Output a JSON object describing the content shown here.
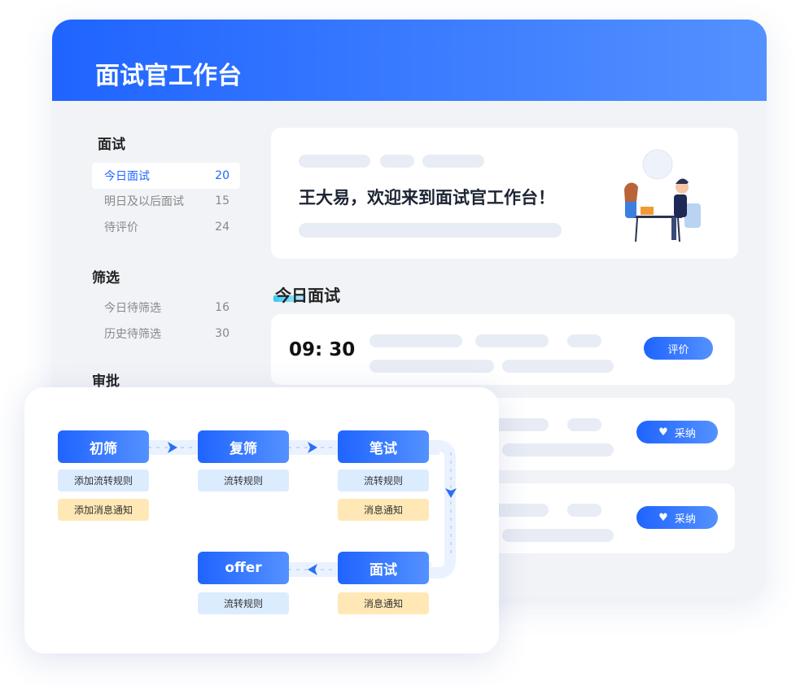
{
  "header": {
    "title": "面试官工作台"
  },
  "sidebar": {
    "sections": [
      {
        "title": "面试",
        "items": [
          {
            "label": "今日面试",
            "count": "20",
            "active": true
          },
          {
            "label": "明日及以后面试",
            "count": "15"
          },
          {
            "label": "待评价",
            "count": "24"
          }
        ]
      },
      {
        "title": "筛选",
        "items": [
          {
            "label": "今日待筛选",
            "count": "16"
          },
          {
            "label": "历史待筛选",
            "count": "30"
          }
        ]
      },
      {
        "title": "审批",
        "items": []
      }
    ]
  },
  "welcome": {
    "text": "王大易，欢迎来到面试官工作台！"
  },
  "today": {
    "heading": "今日面试",
    "rows": [
      {
        "time": "09: 30",
        "button": "评价",
        "icon": "none"
      },
      {
        "button": "采纳",
        "icon": "heart-icon"
      },
      {
        "button": "采纳",
        "icon": "heart-icon"
      }
    ]
  },
  "flow": {
    "nodes": [
      {
        "label": "初筛",
        "subs": [
          "添加流转规则",
          "添加消息通知"
        ]
      },
      {
        "label": "复筛",
        "subs": [
          "流转规则"
        ]
      },
      {
        "label": "笔试",
        "subs": [
          "流转规则",
          "消息通知"
        ]
      },
      {
        "label": "面试",
        "subs": [
          "消息通知"
        ]
      },
      {
        "label": "offer",
        "subs": [
          "流转规则"
        ]
      }
    ]
  },
  "colors": {
    "primary": "#1f66ff",
    "rule": "#dcecff",
    "notice": "#ffe8b5"
  }
}
